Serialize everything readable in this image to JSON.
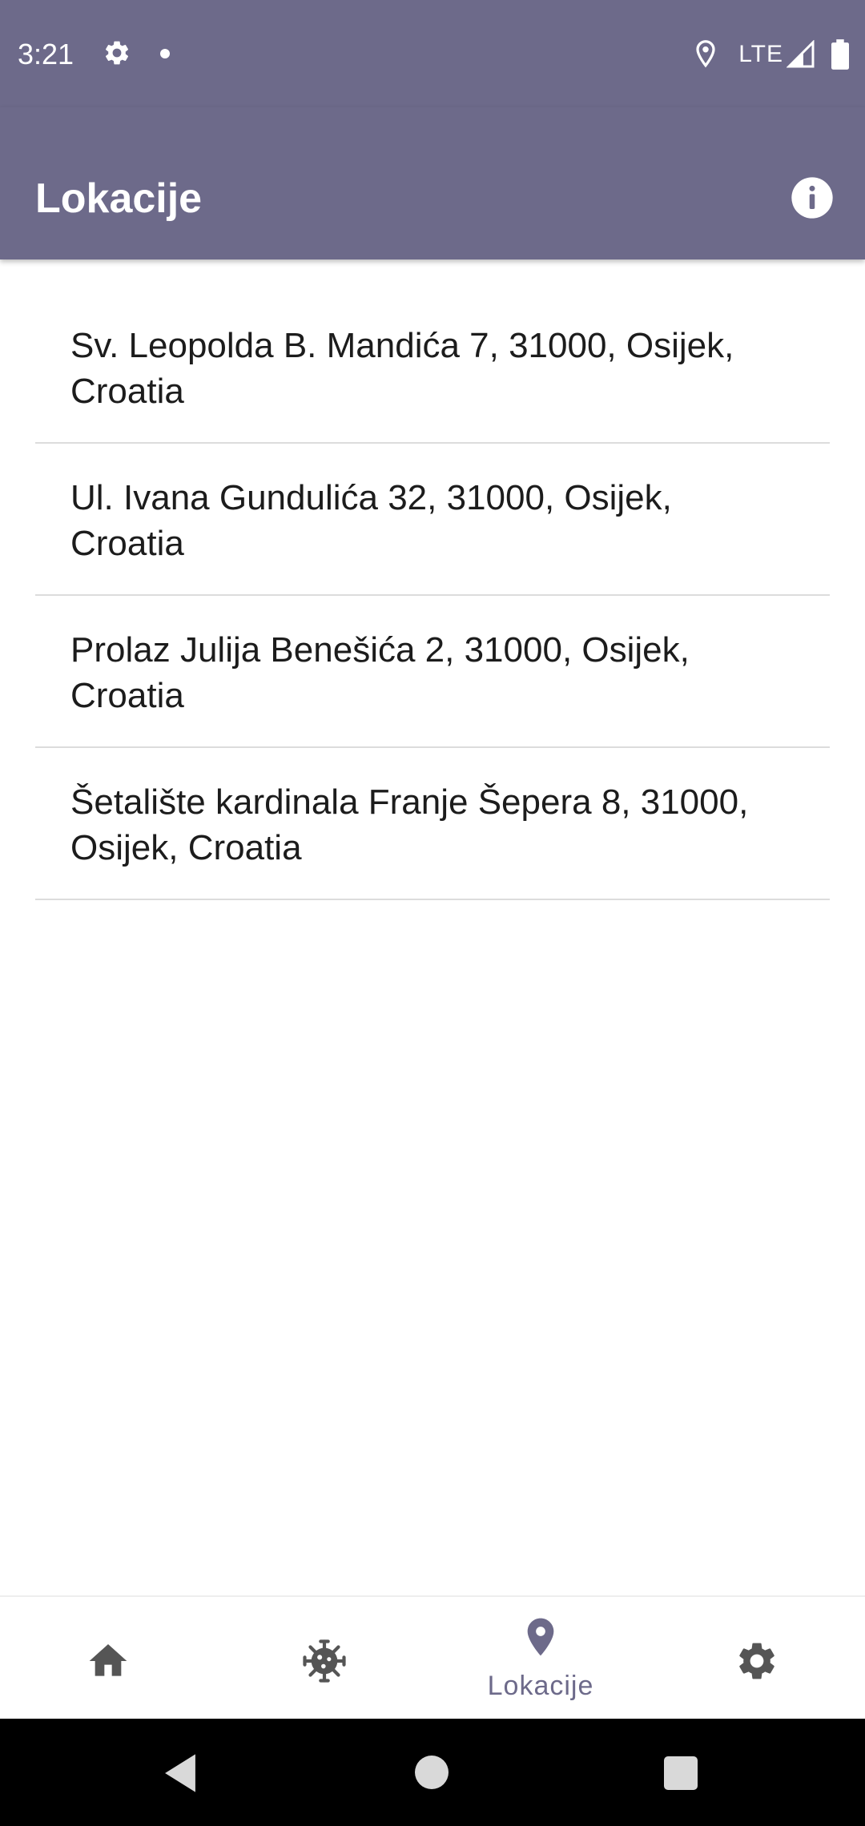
{
  "status_bar": {
    "time": "3:21",
    "network": "LTE",
    "icons": [
      "settings-icon",
      "notification-dot",
      "location-icon",
      "signal-icon",
      "battery-icon"
    ]
  },
  "app_bar": {
    "title": "Lokacije",
    "info_icon": "info-icon"
  },
  "locations": [
    "Sv. Leopolda B. Mandića 7, 31000, Osijek, Croatia",
    "Ul. Ivana Gundulića 32, 31000, Osijek, Croatia",
    "Prolaz Julija Benešića 2, 31000, Osijek, Croatia",
    "Šetalište kardinala Franje Šepera 8, 31000, Osijek, Croatia"
  ],
  "bottom_nav": {
    "items": [
      {
        "icon": "home-icon",
        "label": ""
      },
      {
        "icon": "virus-icon",
        "label": ""
      },
      {
        "icon": "location-pin-icon",
        "label": "Lokacije",
        "active": true
      },
      {
        "icon": "settings-icon",
        "label": ""
      }
    ]
  },
  "colors": {
    "primary": "#6d6a8a",
    "icon_inactive": "#555555",
    "text": "#1c1c1c",
    "divider": "#dcdcdc"
  }
}
